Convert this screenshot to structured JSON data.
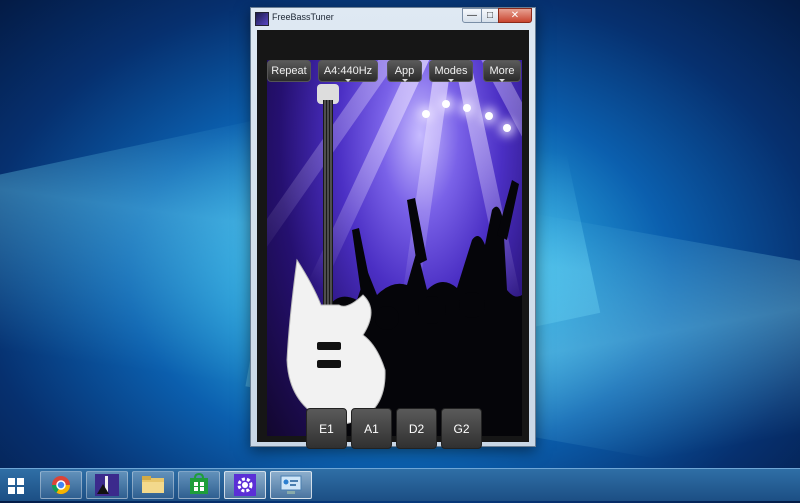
{
  "window": {
    "title": "FreeBassTuner"
  },
  "controls": {
    "min": "—",
    "max": "□",
    "close": "✕"
  },
  "toolbar": {
    "repeat": "Repeat",
    "pitch": "A4:440Hz",
    "app": "App",
    "modes": "Modes",
    "more": "More"
  },
  "strings": [
    "E1",
    "A1",
    "D2",
    "G2"
  ],
  "colors": {
    "stage_accent": "#5b3fe0",
    "desktop_accent": "#2aa8e0"
  },
  "taskbar": {
    "items": [
      "chrome-icon",
      "freebasstuner-icon",
      "file-explorer-icon",
      "store-icon",
      "settings-gear-icon",
      "control-panel-icon"
    ]
  }
}
